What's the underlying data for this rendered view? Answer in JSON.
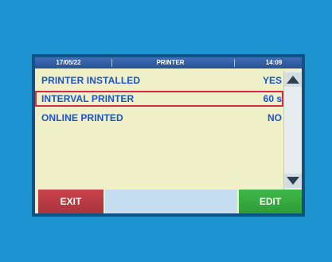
{
  "header": {
    "date": "17/05/22",
    "title": "PRINTER",
    "time": "14:09"
  },
  "settings": [
    {
      "label": "PRINTER INSTALLED",
      "value": "YES",
      "selected": false
    },
    {
      "label": "INTERVAL PRINTER",
      "value": "60 s",
      "selected": true
    },
    {
      "label": "ONLINE PRINTED",
      "value": "NO",
      "selected": false
    }
  ],
  "buttons": {
    "exit": "EXIT",
    "edit": "EDIT"
  },
  "colors": {
    "background": "#1e93d2",
    "screen": "#eff0c7",
    "header_bar": "#2a4f93",
    "label_text": "#1b53c9",
    "selection_outline": "#d42a4a",
    "exit_button": "#b83a42",
    "edit_button": "#36aa40"
  }
}
